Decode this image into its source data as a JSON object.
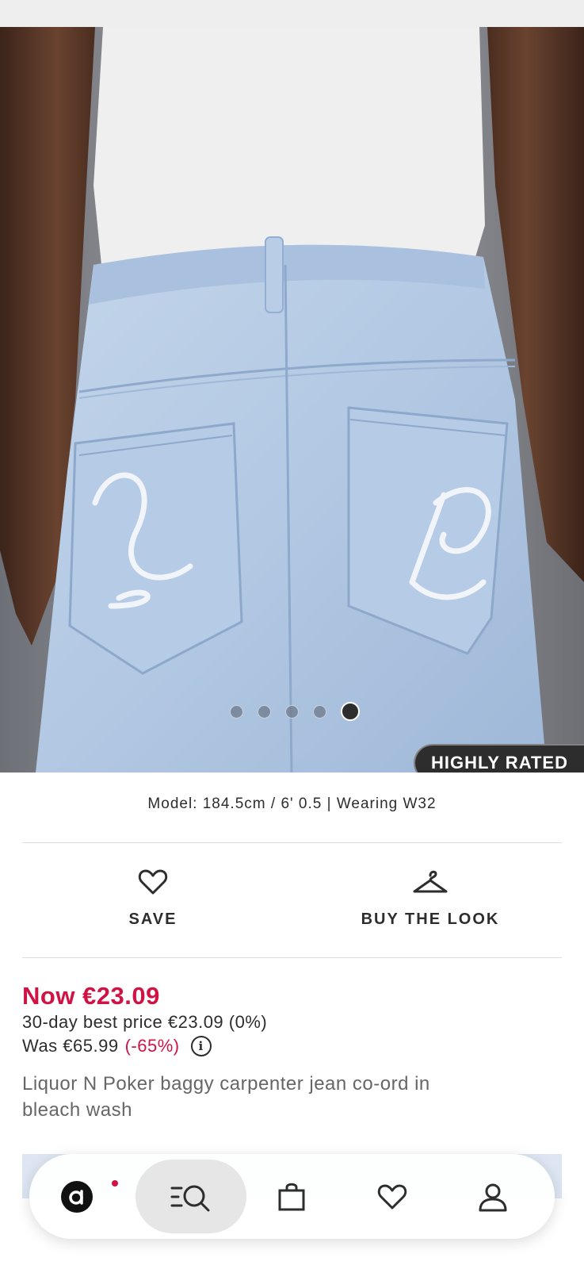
{
  "carousel": {
    "slide_count": 5,
    "active_index": 4,
    "badge": "HIGHLY RATED"
  },
  "model_info": "Model: 184.5cm / 6' 0.5 | Wearing W32",
  "actions": {
    "save_label": "SAVE",
    "buy_the_look_label": "BUY THE LOOK"
  },
  "pricing": {
    "now": "Now €23.09",
    "best_price": "30-day best price €23.09 (0%)",
    "was": "Was €65.99",
    "discount": "(-65%)"
  },
  "product_name": "Liquor N Poker baggy carpenter jean co-ord in bleach wash",
  "bottom_nav": {
    "items": [
      {
        "name": "home",
        "icon": "asos-logo-icon",
        "has_notification": true
      },
      {
        "name": "search",
        "icon": "search-menu-icon",
        "active": true
      },
      {
        "name": "bag",
        "icon": "bag-icon"
      },
      {
        "name": "saved",
        "icon": "heart-icon"
      },
      {
        "name": "account",
        "icon": "user-icon"
      }
    ]
  },
  "colors": {
    "accent_red": "#d01345",
    "text_dark": "#2d2d2d",
    "text_muted": "#666666",
    "denim": "#b5cbe6"
  }
}
